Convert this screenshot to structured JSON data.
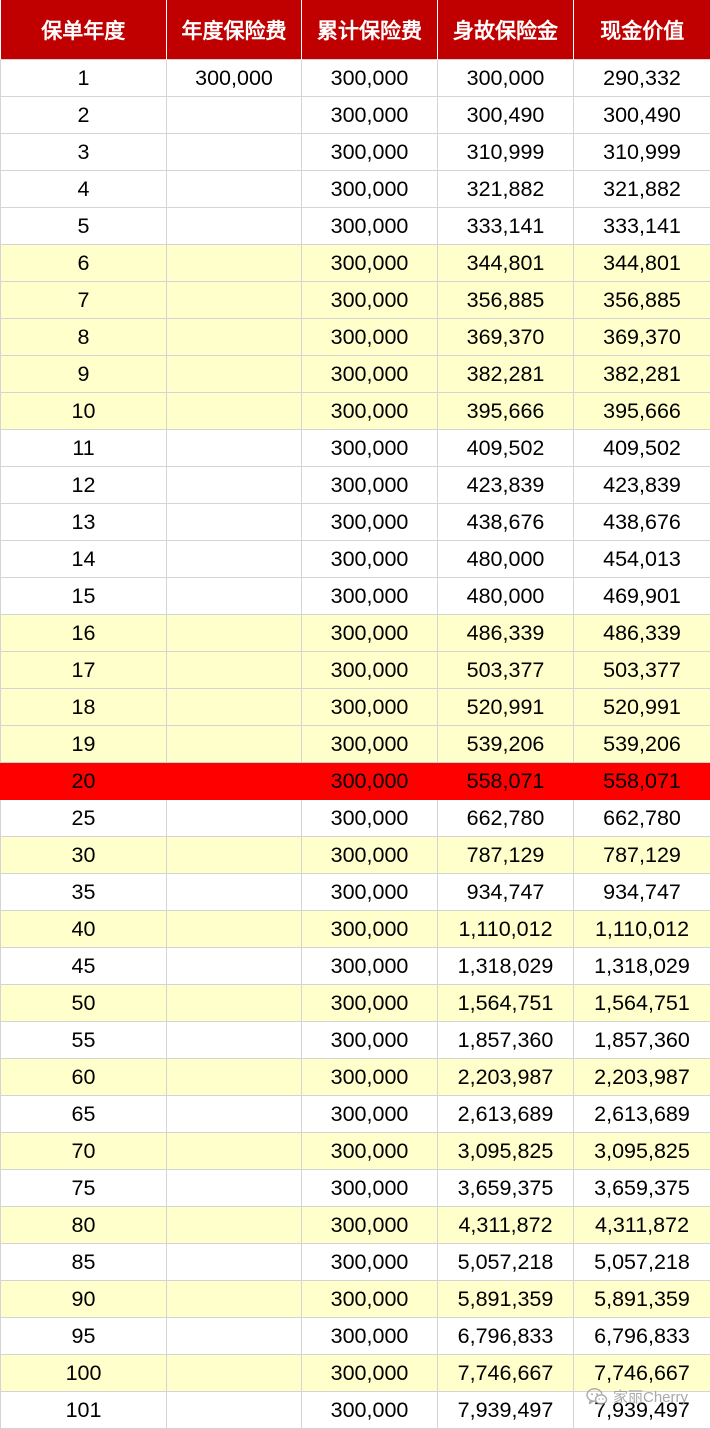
{
  "table": {
    "headers": [
      "保单年度",
      "年度保险费",
      "累计保险费",
      "身故保险金",
      "现金价值"
    ],
    "rows": [
      {
        "band": "white",
        "cells": [
          "1",
          "300,000",
          "300,000",
          "300,000",
          "290,332"
        ]
      },
      {
        "band": "white",
        "cells": [
          "2",
          "",
          "300,000",
          "300,490",
          "300,490"
        ]
      },
      {
        "band": "white",
        "cells": [
          "3",
          "",
          "300,000",
          "310,999",
          "310,999"
        ]
      },
      {
        "band": "white",
        "cells": [
          "4",
          "",
          "300,000",
          "321,882",
          "321,882"
        ]
      },
      {
        "band": "white",
        "cells": [
          "5",
          "",
          "300,000",
          "333,141",
          "333,141"
        ]
      },
      {
        "band": "yellow",
        "cells": [
          "6",
          "",
          "300,000",
          "344,801",
          "344,801"
        ]
      },
      {
        "band": "yellow",
        "cells": [
          "7",
          "",
          "300,000",
          "356,885",
          "356,885"
        ]
      },
      {
        "band": "yellow",
        "cells": [
          "8",
          "",
          "300,000",
          "369,370",
          "369,370"
        ]
      },
      {
        "band": "yellow",
        "cells": [
          "9",
          "",
          "300,000",
          "382,281",
          "382,281"
        ]
      },
      {
        "band": "yellow",
        "cells": [
          "10",
          "",
          "300,000",
          "395,666",
          "395,666"
        ]
      },
      {
        "band": "white",
        "cells": [
          "11",
          "",
          "300,000",
          "409,502",
          "409,502"
        ]
      },
      {
        "band": "white",
        "cells": [
          "12",
          "",
          "300,000",
          "423,839",
          "423,839"
        ]
      },
      {
        "band": "white",
        "cells": [
          "13",
          "",
          "300,000",
          "438,676",
          "438,676"
        ]
      },
      {
        "band": "white",
        "cells": [
          "14",
          "",
          "300,000",
          "480,000",
          "454,013"
        ]
      },
      {
        "band": "white",
        "cells": [
          "15",
          "",
          "300,000",
          "480,000",
          "469,901"
        ]
      },
      {
        "band": "yellow",
        "cells": [
          "16",
          "",
          "300,000",
          "486,339",
          "486,339"
        ]
      },
      {
        "band": "yellow",
        "cells": [
          "17",
          "",
          "300,000",
          "503,377",
          "503,377"
        ]
      },
      {
        "band": "yellow",
        "cells": [
          "18",
          "",
          "300,000",
          "520,991",
          "520,991"
        ]
      },
      {
        "band": "yellow",
        "cells": [
          "19",
          "",
          "300,000",
          "539,206",
          "539,206"
        ]
      },
      {
        "band": "red",
        "cells": [
          "20",
          "",
          "300,000",
          "558,071",
          "558,071"
        ]
      },
      {
        "band": "white",
        "cells": [
          "25",
          "",
          "300,000",
          "662,780",
          "662,780"
        ]
      },
      {
        "band": "yellow",
        "cells": [
          "30",
          "",
          "300,000",
          "787,129",
          "787,129"
        ]
      },
      {
        "band": "white",
        "cells": [
          "35",
          "",
          "300,000",
          "934,747",
          "934,747"
        ]
      },
      {
        "band": "yellow",
        "cells": [
          "40",
          "",
          "300,000",
          "1,110,012",
          "1,110,012"
        ]
      },
      {
        "band": "white",
        "cells": [
          "45",
          "",
          "300,000",
          "1,318,029",
          "1,318,029"
        ]
      },
      {
        "band": "yellow",
        "cells": [
          "50",
          "",
          "300,000",
          "1,564,751",
          "1,564,751"
        ]
      },
      {
        "band": "white",
        "cells": [
          "55",
          "",
          "300,000",
          "1,857,360",
          "1,857,360"
        ]
      },
      {
        "band": "yellow",
        "cells": [
          "60",
          "",
          "300,000",
          "2,203,987",
          "2,203,987"
        ]
      },
      {
        "band": "white",
        "cells": [
          "65",
          "",
          "300,000",
          "2,613,689",
          "2,613,689"
        ]
      },
      {
        "band": "yellow",
        "cells": [
          "70",
          "",
          "300,000",
          "3,095,825",
          "3,095,825"
        ]
      },
      {
        "band": "white",
        "cells": [
          "75",
          "",
          "300,000",
          "3,659,375",
          "3,659,375"
        ]
      },
      {
        "band": "yellow",
        "cells": [
          "80",
          "",
          "300,000",
          "4,311,872",
          "4,311,872"
        ]
      },
      {
        "band": "white",
        "cells": [
          "85",
          "",
          "300,000",
          "5,057,218",
          "5,057,218"
        ]
      },
      {
        "band": "yellow",
        "cells": [
          "90",
          "",
          "300,000",
          "5,891,359",
          "5,891,359"
        ]
      },
      {
        "band": "white",
        "cells": [
          "95",
          "",
          "300,000",
          "6,796,833",
          "6,796,833"
        ]
      },
      {
        "band": "yellow",
        "cells": [
          "100",
          "",
          "300,000",
          "7,746,667",
          "7,746,667"
        ]
      },
      {
        "band": "white",
        "cells": [
          "101",
          "",
          "300,000",
          "7,939,497",
          "7,939,497"
        ]
      }
    ]
  },
  "colors": {
    "header_bg": "#c00000",
    "header_text": "#ffffff",
    "band_yellow": "#ffffcc",
    "band_red": "#ff0000",
    "grid": "#d4d4d4"
  },
  "watermark": {
    "icon": "wechat-icon",
    "text": "家丽Cherry"
  }
}
